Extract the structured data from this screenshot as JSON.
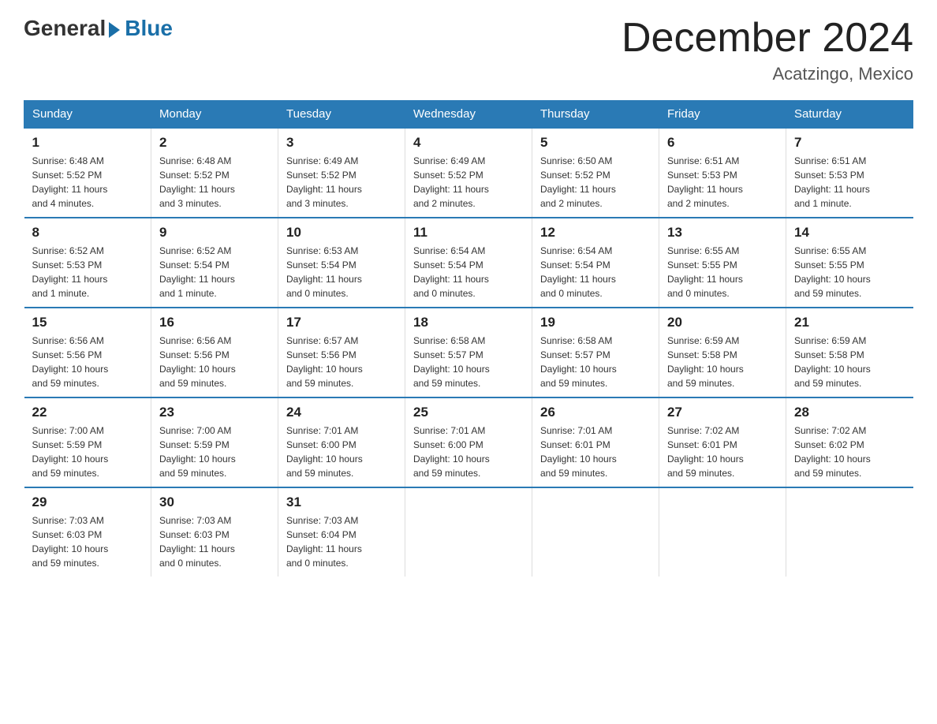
{
  "header": {
    "logo_general": "General",
    "logo_blue": "Blue",
    "title": "December 2024",
    "location": "Acatzingo, Mexico"
  },
  "days_of_week": [
    "Sunday",
    "Monday",
    "Tuesday",
    "Wednesday",
    "Thursday",
    "Friday",
    "Saturday"
  ],
  "weeks": [
    [
      {
        "day": "1",
        "sunrise": "6:48 AM",
        "sunset": "5:52 PM",
        "daylight": "11 hours and 4 minutes."
      },
      {
        "day": "2",
        "sunrise": "6:48 AM",
        "sunset": "5:52 PM",
        "daylight": "11 hours and 3 minutes."
      },
      {
        "day": "3",
        "sunrise": "6:49 AM",
        "sunset": "5:52 PM",
        "daylight": "11 hours and 3 minutes."
      },
      {
        "day": "4",
        "sunrise": "6:49 AM",
        "sunset": "5:52 PM",
        "daylight": "11 hours and 2 minutes."
      },
      {
        "day": "5",
        "sunrise": "6:50 AM",
        "sunset": "5:52 PM",
        "daylight": "11 hours and 2 minutes."
      },
      {
        "day": "6",
        "sunrise": "6:51 AM",
        "sunset": "5:53 PM",
        "daylight": "11 hours and 2 minutes."
      },
      {
        "day": "7",
        "sunrise": "6:51 AM",
        "sunset": "5:53 PM",
        "daylight": "11 hours and 1 minute."
      }
    ],
    [
      {
        "day": "8",
        "sunrise": "6:52 AM",
        "sunset": "5:53 PM",
        "daylight": "11 hours and 1 minute."
      },
      {
        "day": "9",
        "sunrise": "6:52 AM",
        "sunset": "5:54 PM",
        "daylight": "11 hours and 1 minute."
      },
      {
        "day": "10",
        "sunrise": "6:53 AM",
        "sunset": "5:54 PM",
        "daylight": "11 hours and 0 minutes."
      },
      {
        "day": "11",
        "sunrise": "6:54 AM",
        "sunset": "5:54 PM",
        "daylight": "11 hours and 0 minutes."
      },
      {
        "day": "12",
        "sunrise": "6:54 AM",
        "sunset": "5:54 PM",
        "daylight": "11 hours and 0 minutes."
      },
      {
        "day": "13",
        "sunrise": "6:55 AM",
        "sunset": "5:55 PM",
        "daylight": "11 hours and 0 minutes."
      },
      {
        "day": "14",
        "sunrise": "6:55 AM",
        "sunset": "5:55 PM",
        "daylight": "10 hours and 59 minutes."
      }
    ],
    [
      {
        "day": "15",
        "sunrise": "6:56 AM",
        "sunset": "5:56 PM",
        "daylight": "10 hours and 59 minutes."
      },
      {
        "day": "16",
        "sunrise": "6:56 AM",
        "sunset": "5:56 PM",
        "daylight": "10 hours and 59 minutes."
      },
      {
        "day": "17",
        "sunrise": "6:57 AM",
        "sunset": "5:56 PM",
        "daylight": "10 hours and 59 minutes."
      },
      {
        "day": "18",
        "sunrise": "6:58 AM",
        "sunset": "5:57 PM",
        "daylight": "10 hours and 59 minutes."
      },
      {
        "day": "19",
        "sunrise": "6:58 AM",
        "sunset": "5:57 PM",
        "daylight": "10 hours and 59 minutes."
      },
      {
        "day": "20",
        "sunrise": "6:59 AM",
        "sunset": "5:58 PM",
        "daylight": "10 hours and 59 minutes."
      },
      {
        "day": "21",
        "sunrise": "6:59 AM",
        "sunset": "5:58 PM",
        "daylight": "10 hours and 59 minutes."
      }
    ],
    [
      {
        "day": "22",
        "sunrise": "7:00 AM",
        "sunset": "5:59 PM",
        "daylight": "10 hours and 59 minutes."
      },
      {
        "day": "23",
        "sunrise": "7:00 AM",
        "sunset": "5:59 PM",
        "daylight": "10 hours and 59 minutes."
      },
      {
        "day": "24",
        "sunrise": "7:01 AM",
        "sunset": "6:00 PM",
        "daylight": "10 hours and 59 minutes."
      },
      {
        "day": "25",
        "sunrise": "7:01 AM",
        "sunset": "6:00 PM",
        "daylight": "10 hours and 59 minutes."
      },
      {
        "day": "26",
        "sunrise": "7:01 AM",
        "sunset": "6:01 PM",
        "daylight": "10 hours and 59 minutes."
      },
      {
        "day": "27",
        "sunrise": "7:02 AM",
        "sunset": "6:01 PM",
        "daylight": "10 hours and 59 minutes."
      },
      {
        "day": "28",
        "sunrise": "7:02 AM",
        "sunset": "6:02 PM",
        "daylight": "10 hours and 59 minutes."
      }
    ],
    [
      {
        "day": "29",
        "sunrise": "7:03 AM",
        "sunset": "6:03 PM",
        "daylight": "10 hours and 59 minutes."
      },
      {
        "day": "30",
        "sunrise": "7:03 AM",
        "sunset": "6:03 PM",
        "daylight": "11 hours and 0 minutes."
      },
      {
        "day": "31",
        "sunrise": "7:03 AM",
        "sunset": "6:04 PM",
        "daylight": "11 hours and 0 minutes."
      },
      null,
      null,
      null,
      null
    ]
  ],
  "labels": {
    "sunrise": "Sunrise:",
    "sunset": "Sunset:",
    "daylight": "Daylight:"
  }
}
